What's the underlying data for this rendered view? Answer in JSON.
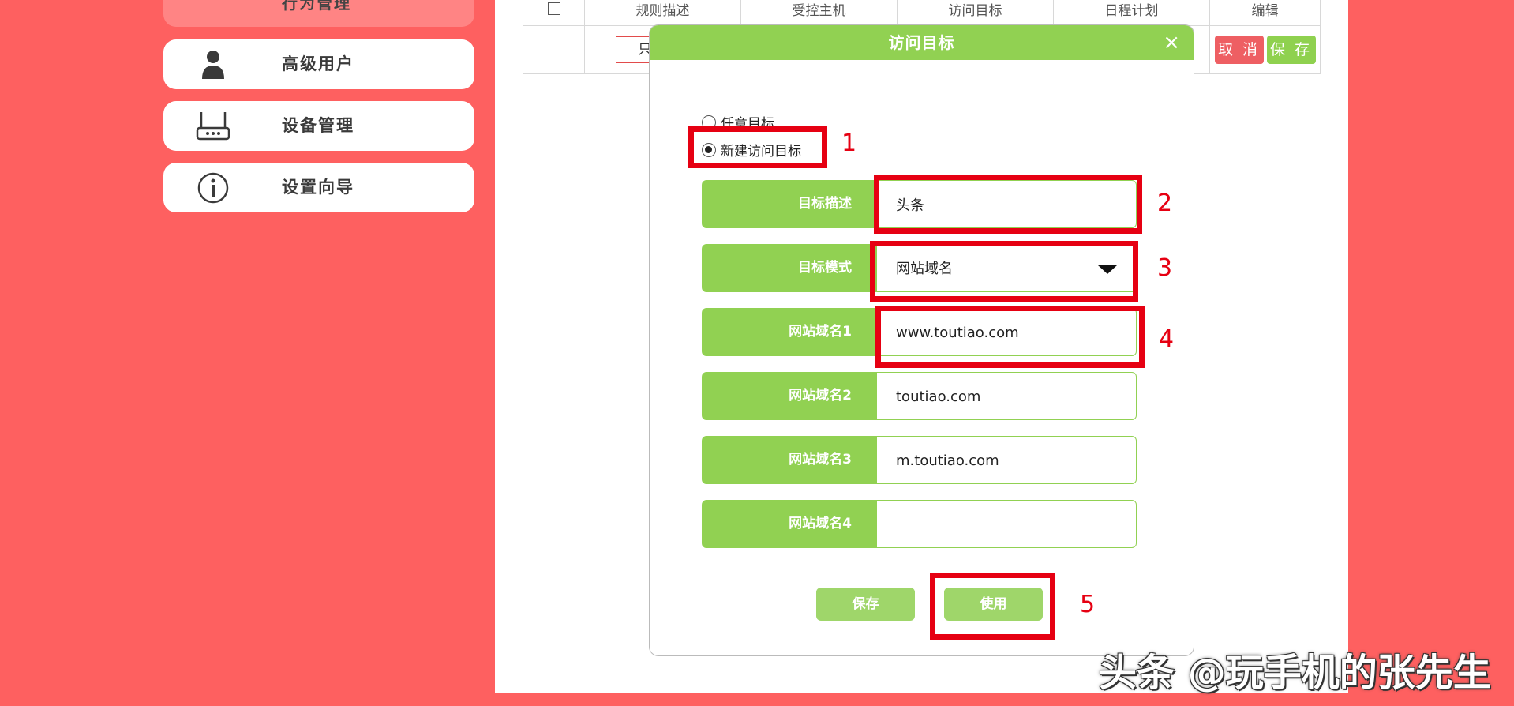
{
  "sidebar": {
    "partial_label": "行为管理",
    "items": [
      {
        "label": "高级用户",
        "icon": "user-icon"
      },
      {
        "label": "设备管理",
        "icon": "router-icon"
      },
      {
        "label": "设置向导",
        "icon": "info-icon"
      }
    ]
  },
  "table": {
    "headers": [
      "规则描述",
      "受控主机",
      "访问目标",
      "日程计划",
      "编辑"
    ],
    "row": {
      "input_value": "只能"
    },
    "cancel_label": "取 消",
    "save_label": "保 存"
  },
  "dialog": {
    "title": "访问目标",
    "close_glyph": "×",
    "radio_any": "任意目标",
    "radio_new": "新建访问目标",
    "fields": {
      "desc_label": "目标描述",
      "desc_value": "头条",
      "mode_label": "目标模式",
      "mode_value": "网站域名",
      "domain1_label": "网站域名1",
      "domain1_value": "www.toutiao.com",
      "domain2_label": "网站域名2",
      "domain2_value": "toutiao.com",
      "domain3_label": "网站域名3",
      "domain3_value": "m.toutiao.com",
      "domain4_label": "网站域名4",
      "domain4_value": ""
    },
    "save_label": "保存",
    "apply_label": "使用"
  },
  "annotations": [
    "1",
    "2",
    "3",
    "4",
    "5"
  ],
  "watermark": "头条 @玩手机的张先生",
  "colors": {
    "background": "#fe6060",
    "accent_green": "#91d152",
    "annotation_red": "#e60012",
    "cancel_red": "#ee5f63"
  }
}
